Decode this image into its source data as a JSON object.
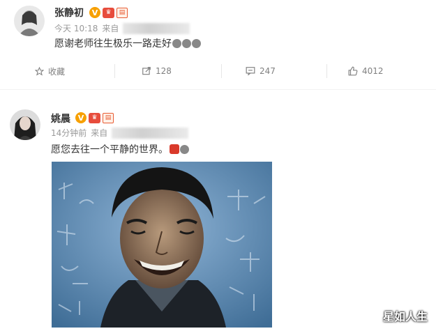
{
  "posts": [
    {
      "user": "张静初",
      "verified_letter": "V",
      "time": "今天 10:18",
      "source_prefix": "来自",
      "text": "愿谢老师往生极乐一路走好",
      "actions": {
        "favorite": "收藏",
        "repost": "128",
        "comment": "247",
        "like": "4012"
      }
    },
    {
      "user": "姚晨",
      "verified_letter": "V",
      "time": "14分钟前",
      "source_prefix": "来自",
      "text": "愿您去往一个平静的世界。"
    }
  ],
  "watermark": "星如人生",
  "colors": {
    "verified": "#f7a000",
    "divider": "#e6e6e6",
    "meta": "#999999"
  }
}
